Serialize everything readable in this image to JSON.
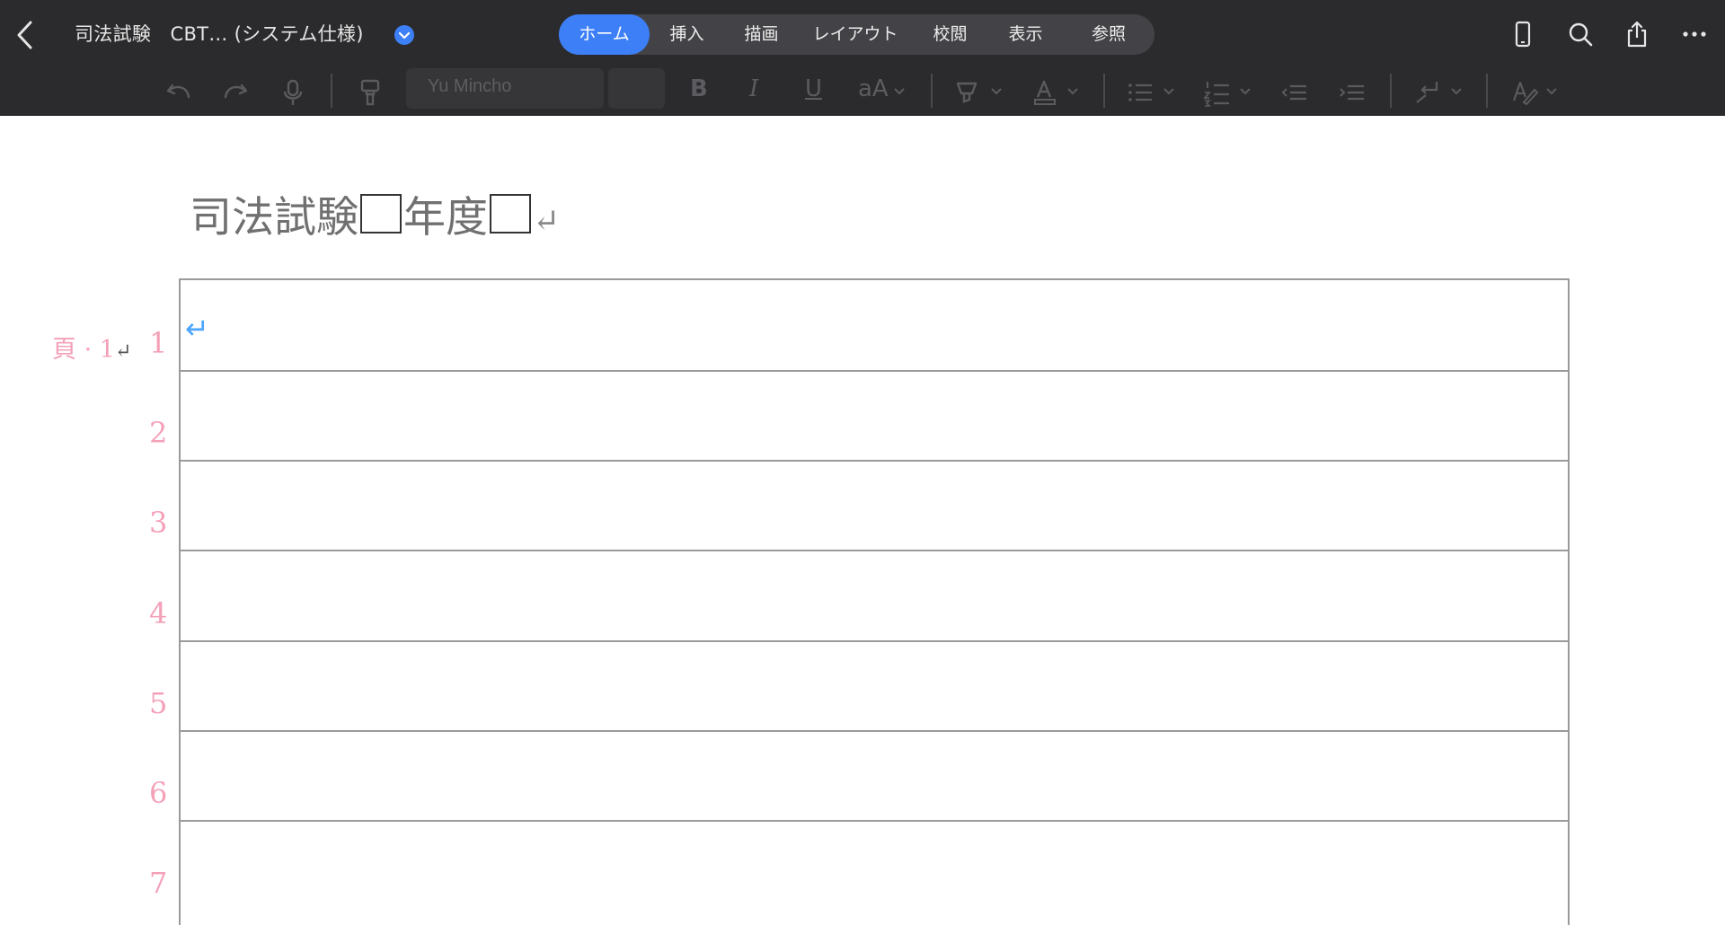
{
  "app": {
    "doc_title": "司法試験　CBT… (システム仕様)",
    "tabs": [
      {
        "label": "ホーム",
        "active": true
      },
      {
        "label": "挿入",
        "active": false
      },
      {
        "label": "描画",
        "active": false
      },
      {
        "label": "レイアウト",
        "active": false
      },
      {
        "label": "校閲",
        "active": false
      },
      {
        "label": "表示",
        "active": false
      },
      {
        "label": "参照",
        "active": false
      }
    ]
  },
  "ribbon": {
    "font_name": "Yu Mincho",
    "font_size": "",
    "bold_label": "B",
    "italic_label": "I",
    "underline_label": "U",
    "text_size_label": "aA"
  },
  "document": {
    "heading_part1": "司法試験",
    "heading_part2": "年度",
    "paragraph_mark": "↵",
    "page_label": "頁 · 1",
    "line_numbers": [
      "1",
      "2",
      "3",
      "4",
      "5",
      "6",
      "7"
    ]
  },
  "colors": {
    "toolbar_bg": "#2b2b2d",
    "active_tab": "#3d7ff6",
    "line_number": "#f4a0b8",
    "cursor_mark": "#4da6ff"
  }
}
